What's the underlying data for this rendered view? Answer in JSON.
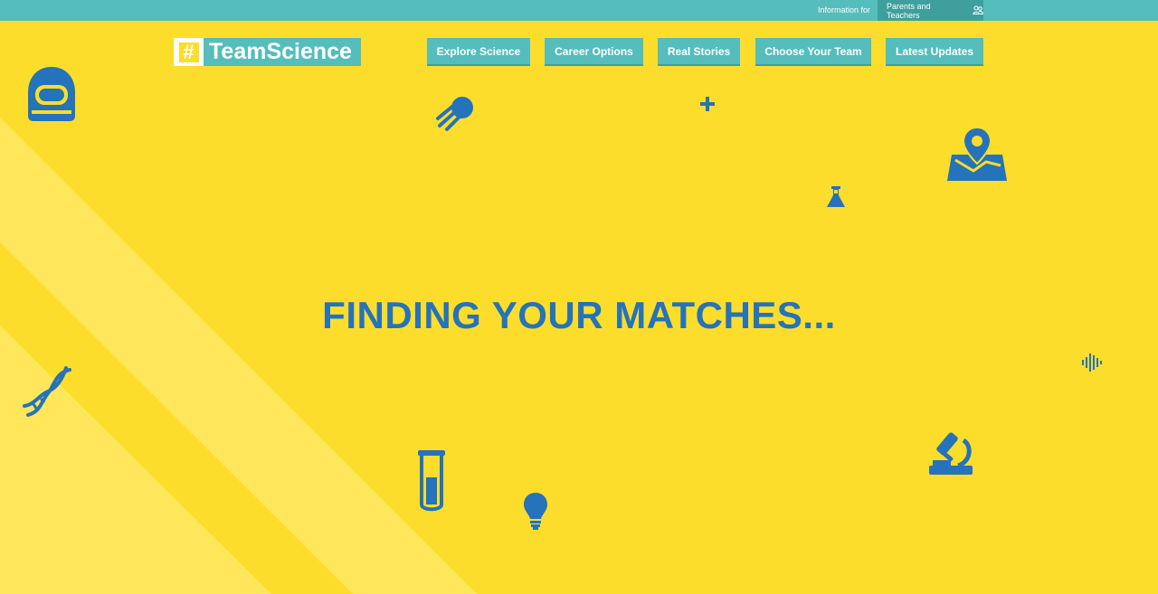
{
  "topbar": {
    "info_label": "Information for",
    "audience_link": "Parents and Teachers",
    "audience_icon": "people-icon"
  },
  "logo": {
    "hash": "#",
    "word": "TeamScience"
  },
  "nav": {
    "items": [
      {
        "label": "Explore Science"
      },
      {
        "label": "Career Options"
      },
      {
        "label": "Real Stories"
      },
      {
        "label": "Choose Your Team"
      },
      {
        "label": "Latest Updates"
      }
    ]
  },
  "main": {
    "headline": "FINDING YOUR MATCHES..."
  },
  "decorations": [
    "astronaut-helmet-icon",
    "comet-icon",
    "plus-icon",
    "map-pin-icon",
    "flask-icon",
    "soundwave-icon",
    "dna-icon",
    "test-tube-icon",
    "lightbulb-icon",
    "microscope-icon"
  ],
  "colors": {
    "background": "#fddd2c",
    "stripe": "#ffe65a",
    "teal": "#55bdbb",
    "teal_dark": "#3f9f9d",
    "icon_blue": "#2473bb"
  }
}
